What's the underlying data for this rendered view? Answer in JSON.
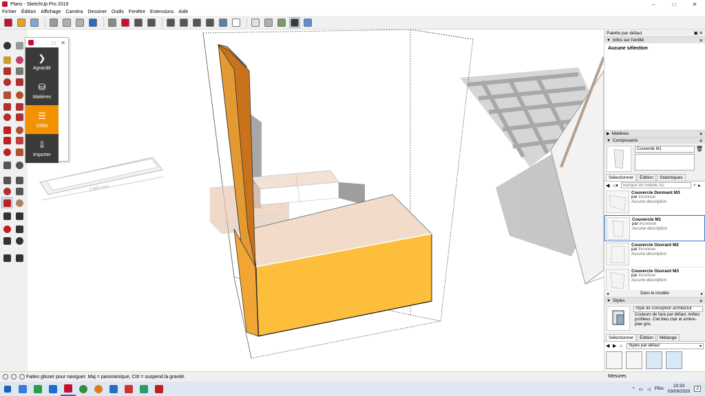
{
  "window": {
    "title": "Plans - SketchUp Pro 2019",
    "min": "–",
    "max": "□",
    "close": "✕"
  },
  "menu": [
    "Fichier",
    "Édition",
    "Affichage",
    "Caméra",
    "Dessiner",
    "Outils",
    "Fenêtre",
    "Extensions",
    "Aide"
  ],
  "toolbar": {
    "colors": [
      "#c8102e",
      "#e8a317",
      "#7aa9d6",
      "#9a9a9a",
      "#b0b0b0",
      "#b0b0b0",
      "#2a6cc0",
      "#8a8a8a",
      "#c8102e",
      "#555555",
      "#555555",
      "#555555",
      "#555555",
      "#555555",
      "#555555",
      "#5b7fa8",
      "#ffffff",
      "#e0e0e0",
      "#b0b0b0",
      "#7a9a6a",
      "#3a3a3a",
      "#5b8fd0"
    ]
  },
  "floating_panel": {
    "items": [
      {
        "label": "Agrandir",
        "icon": "chevron-right-icon",
        "glyph": "❯"
      },
      {
        "label": "Matières",
        "icon": "paint-bucket-icon",
        "glyph": "⛁"
      },
      {
        "label": "Débit",
        "icon": "cut-list-icon",
        "glyph": "☰"
      },
      {
        "label": "Importer",
        "icon": "import-icon",
        "glyph": "⇩"
      }
    ]
  },
  "viewport": {
    "dimension_label": "1340 mm"
  },
  "tray": {
    "title": "Palette par défaut",
    "entity_info": {
      "header": "Infos sur l'entité",
      "value": "Aucune sélection"
    },
    "materials_header": "Matières",
    "components": {
      "header": "Composants",
      "name_field": "Couverde M1",
      "tabs": [
        "Sélectionner",
        "Édition",
        "Statistiques"
      ],
      "search_placeholder": "Banque de modèle 3D",
      "items": [
        {
          "name": "Couvercle Dormant M3",
          "by": "par",
          "author": "Inconnue",
          "desc": "Aucune description"
        },
        {
          "name": "Couvercle M1",
          "by": "par",
          "author": "Inconnue",
          "desc": "Aucune description"
        },
        {
          "name": "Couvercle Ouvrant  M2",
          "by": "par",
          "author": "Inconnue",
          "desc": "Aucune description"
        },
        {
          "name": "Couvercle Ouvrant  M3",
          "by": "par",
          "author": "Inconnue",
          "desc": "Aucune description"
        }
      ],
      "footer": "Dans le modèle"
    },
    "styles": {
      "header": "Styles",
      "name": "Style de conception architectur",
      "desc": "Couleurs de face par défaut. Arêtes profilées. Ciel bleu clair et arrière-plan gris.",
      "tabs": [
        "Sélectionner",
        "Édition",
        "Mélange"
      ],
      "dropdown": "Styles par défaut"
    }
  },
  "statusbar": {
    "hint": "Faites glisser pour naviguer. Maj = panoramique, Ctrl =  suspend la gravité.",
    "measures": "Mesures"
  },
  "taskbar": {
    "colors": [
      "#3c7ad6",
      "#2b9a4a",
      "#1d6ad0",
      "#c8102e",
      "#3a8a3a",
      "#e07a20",
      "#2a6cc0",
      "#d03030",
      "#2a9a6a",
      "#c02020"
    ],
    "lang": "FRA",
    "time": "10:33",
    "date": "03/09/2020",
    "notif": "2"
  }
}
